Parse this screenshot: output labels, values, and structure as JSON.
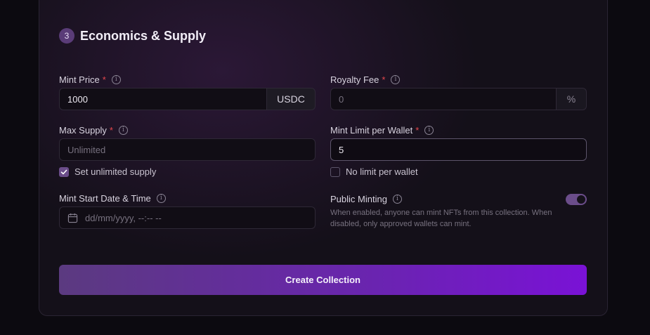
{
  "section": {
    "step": "3",
    "title": "Economics & Supply"
  },
  "mint_price": {
    "label": "Mint Price",
    "required_mark": "*",
    "value": "1000",
    "currency": "USDC"
  },
  "royalty_fee": {
    "label": "Royalty Fee",
    "required_mark": "*",
    "placeholder": "0",
    "unit": "%"
  },
  "max_supply": {
    "label": "Max Supply",
    "required_mark": "*",
    "placeholder": "Unlimited",
    "checkbox_label": "Set unlimited supply",
    "checked": true
  },
  "mint_limit": {
    "label": "Mint Limit per Wallet",
    "required_mark": "*",
    "value": "5",
    "checkbox_label": "No limit per wallet",
    "checked": false
  },
  "mint_start": {
    "label": "Mint Start Date & Time",
    "placeholder": "dd/mm/yyyy, --:-- --"
  },
  "public_minting": {
    "label": "Public Minting",
    "enabled": true,
    "description": "When enabled, anyone can mint NFTs from this collection. When disabled, only approved wallets can mint."
  },
  "create_button": {
    "label": "Create Collection"
  },
  "colors": {
    "accent": "#6b4d8a",
    "button_start": "#5b3a80",
    "button_end": "#7a12d6",
    "required": "#e5484d"
  },
  "icons": {
    "info": "info-icon",
    "calendar": "calendar-icon",
    "check": "check-icon"
  }
}
